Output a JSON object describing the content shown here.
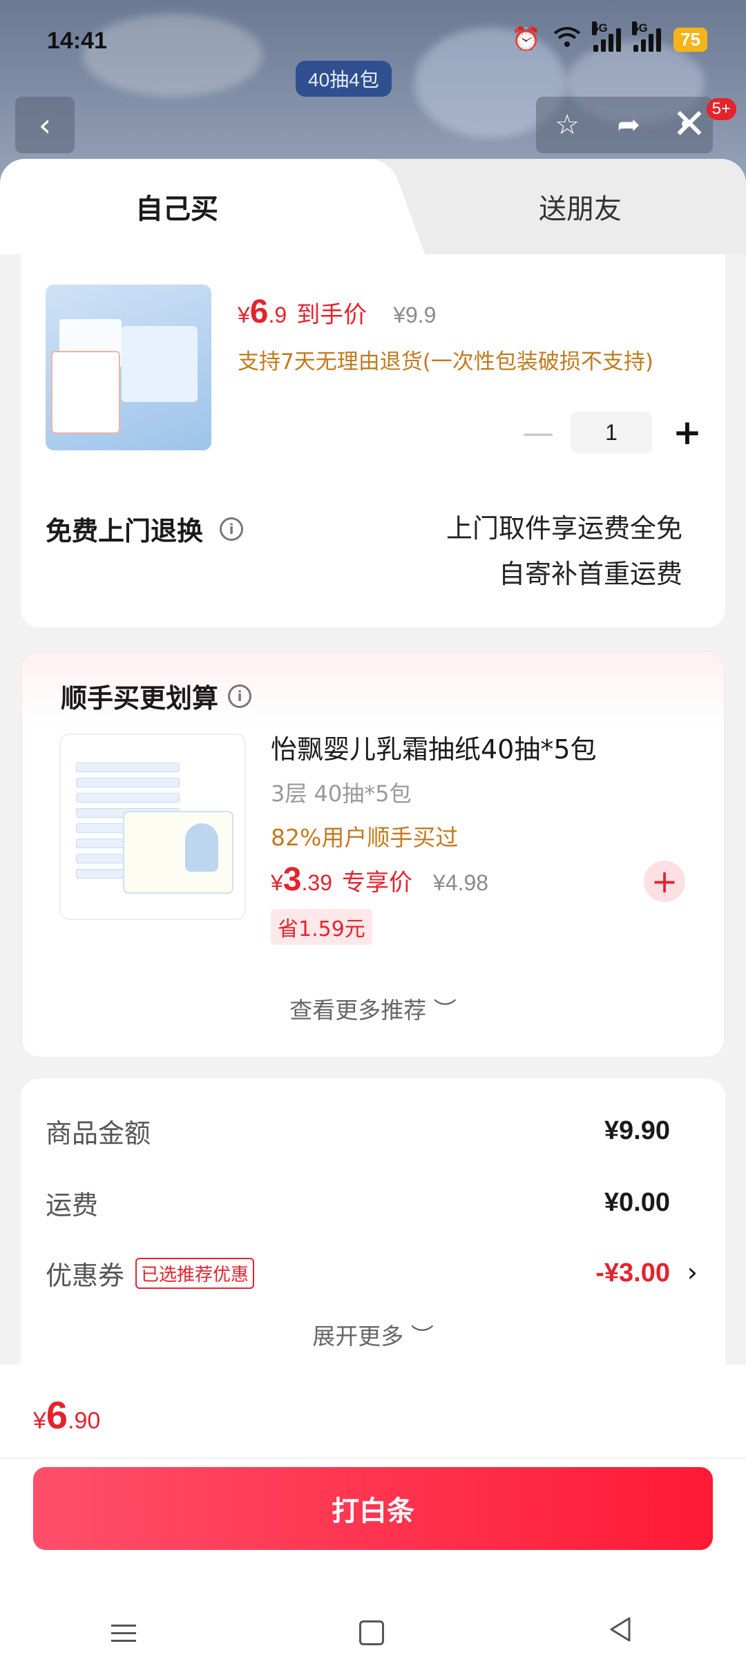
{
  "status": {
    "time": "14:41",
    "net1": "5G",
    "net2": "5G",
    "battery": "75"
  },
  "backdrop": {
    "pack_tag": "40抽4包",
    "badge": "5+"
  },
  "tabs": {
    "self": "自己买",
    "friend": "送朋友"
  },
  "product": {
    "price_yen": "¥",
    "price_int": "6",
    "price_dec": ".9",
    "price_label": "到手价",
    "orig_price": "¥9.9",
    "return_note": "支持7天无理由退货(一次性包装破损不支持)",
    "quantity": "1"
  },
  "free_return": {
    "title": "免费上门退换",
    "line1": "上门取件享运费全免",
    "line2": "自寄补首重运费"
  },
  "recommend": {
    "title": "顺手买更划算",
    "name": "怡飘婴儿乳霜抽纸40抽*5包",
    "spec": "3层 40抽*5包",
    "bought": "82%用户顺手买过",
    "price_yen": "¥",
    "price_int": "3",
    "price_dec": ".39",
    "price_label": "专享价",
    "orig_price": "¥4.98",
    "save": "省1.59元",
    "more": "查看更多推荐 ︶"
  },
  "summary": {
    "goods_label": "商品金额",
    "goods_value": "¥9.90",
    "shipping_label": "运费",
    "shipping_value": "¥0.00",
    "coupon_label": "优惠券",
    "coupon_tag": "已选推荐优惠",
    "coupon_value": "-¥3.00",
    "expand": "展开更多 ︶"
  },
  "footer": {
    "total_yen": "¥",
    "total_int": "6",
    "total_dec": ".90",
    "pay_button": "打白条"
  }
}
